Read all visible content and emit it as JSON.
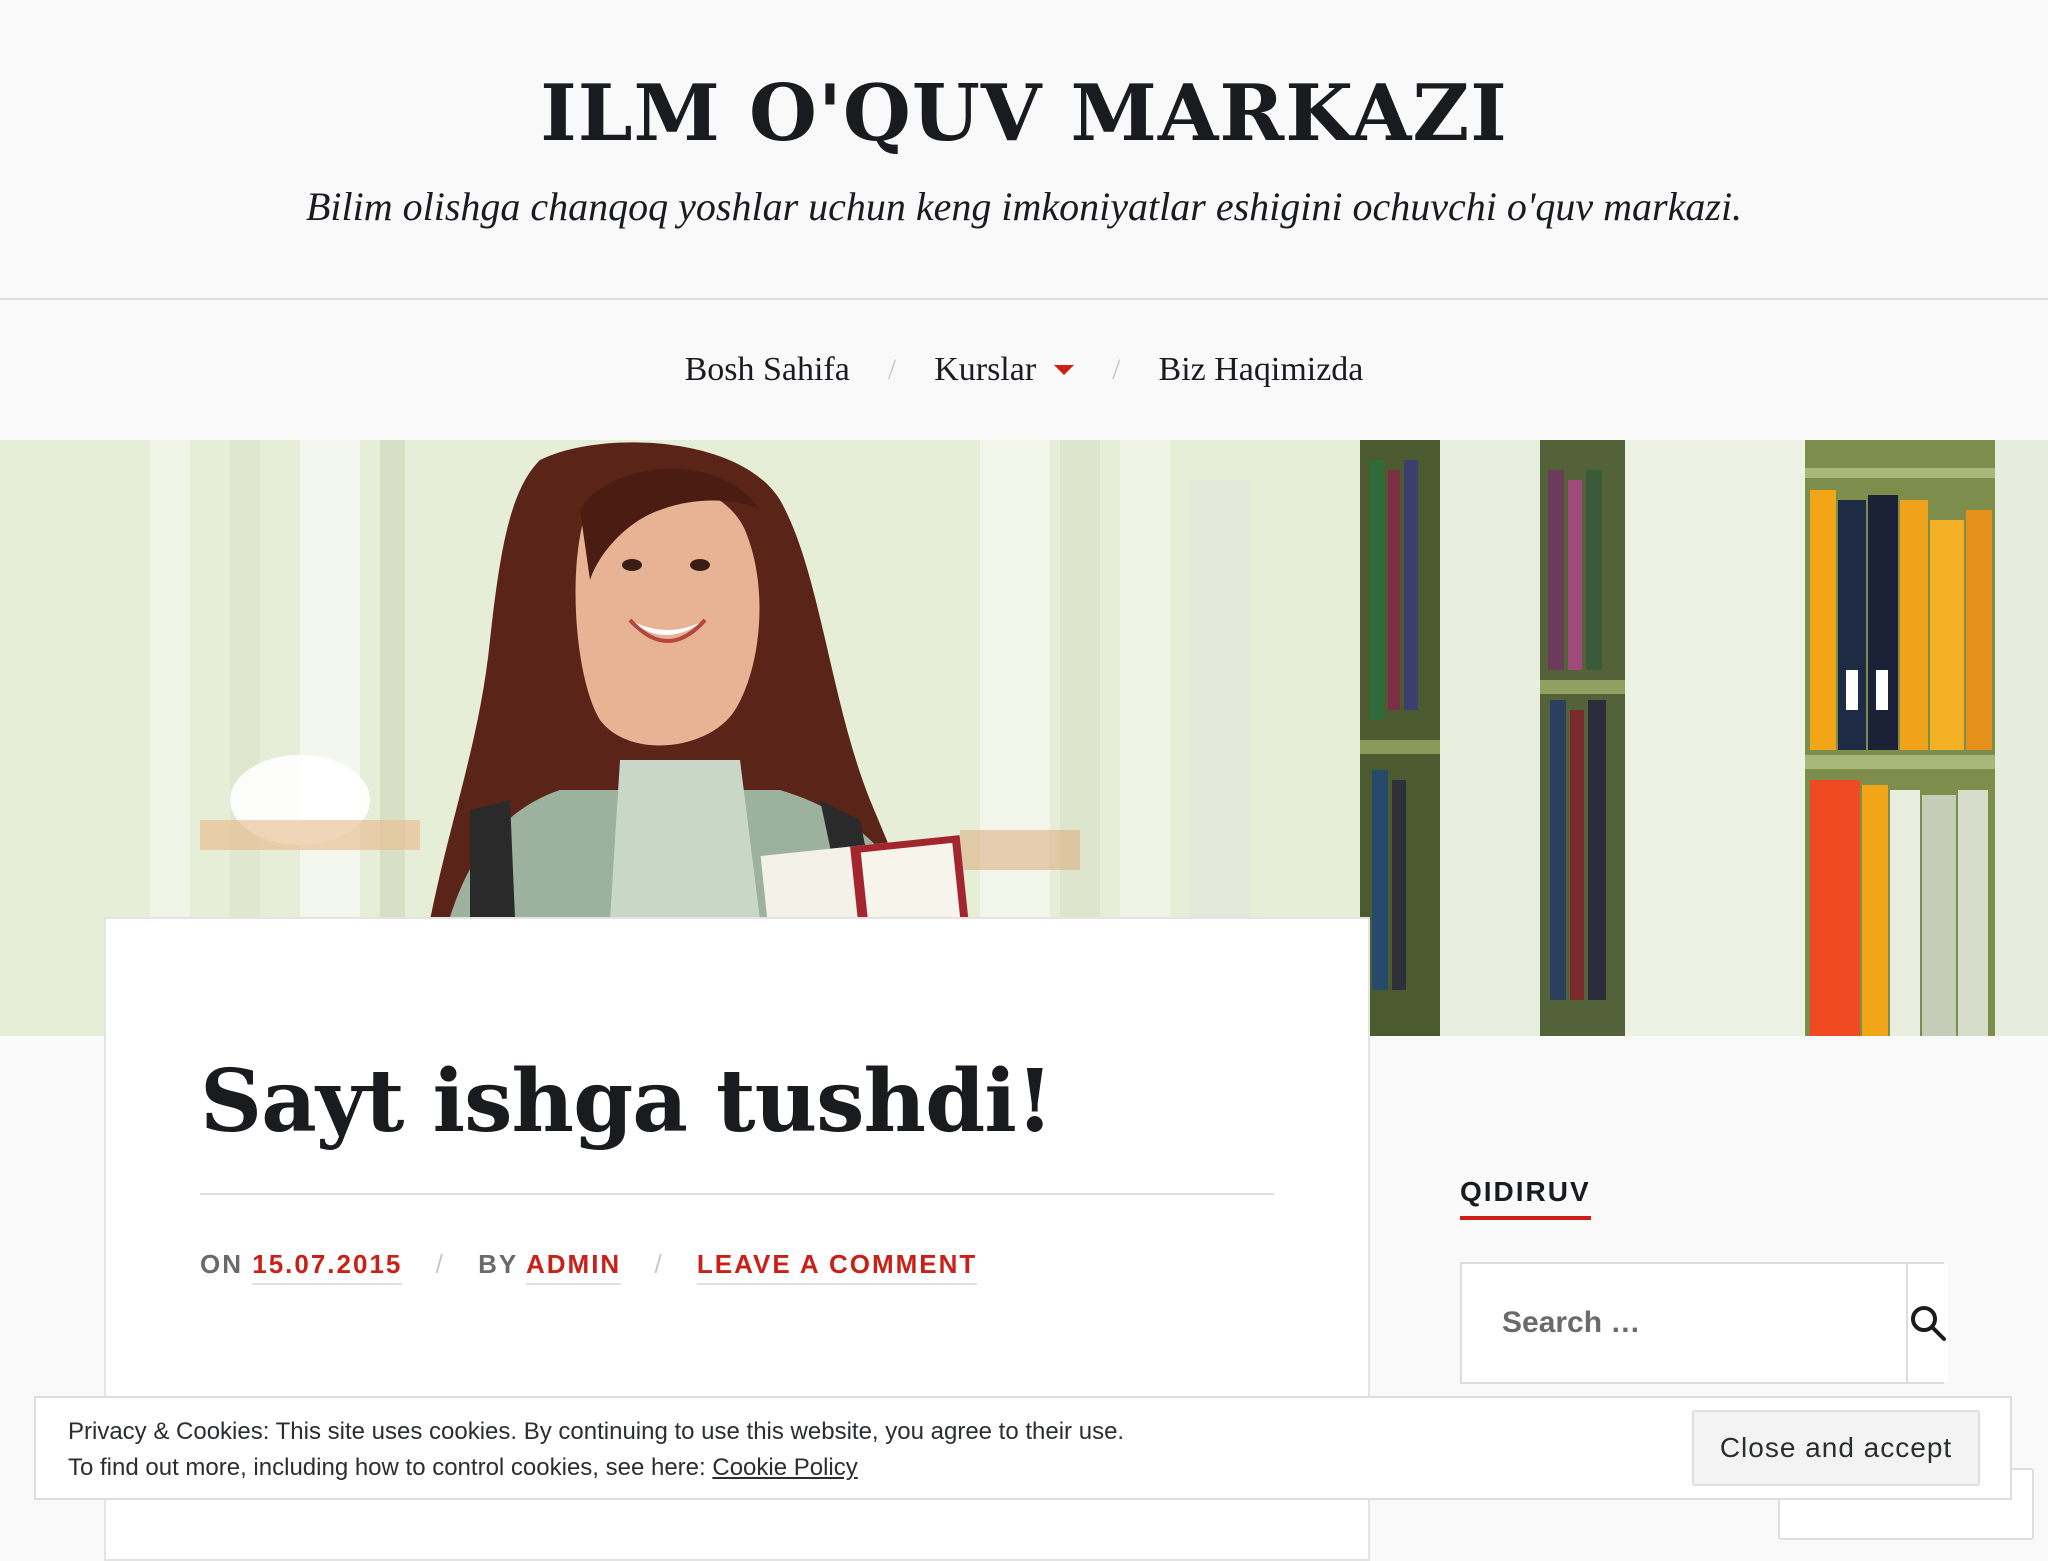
{
  "site": {
    "title": "ILM O'QUV MARKAZI",
    "tagline": "Bilim olishga chanqoq yoshlar uchun keng imkoniyatlar eshigini ochuvchi o'quv markazi."
  },
  "nav": {
    "items": [
      {
        "label": "Bosh Sahifa"
      },
      {
        "label": "Kurslar",
        "has_dropdown": true
      },
      {
        "label": "Biz Haqimizda"
      }
    ],
    "separator": "/"
  },
  "post": {
    "title": "Sayt ishga tushdi!",
    "meta_on": "On",
    "date": "15.07.2015",
    "meta_by": "By",
    "author": "admin",
    "comment_link": "Leave a comment"
  },
  "sidebar": {
    "search_title": "QIDIRUV",
    "search_placeholder": "Search …"
  },
  "cookie": {
    "line1": "Privacy & Cookies: This site uses cookies. By continuing to use this website, you agree to their use.",
    "line2_prefix": "To find out more, including how to control cookies, see here:",
    "policy_link": "Cookie Policy",
    "accept_label": "Close and accept"
  },
  "colors": {
    "accent": "#ca2017",
    "text": "#1a1b1f",
    "background": "#f9f9f9"
  },
  "icons": {
    "nav_dropdown": "caret-down-icon",
    "search": "search-icon"
  }
}
